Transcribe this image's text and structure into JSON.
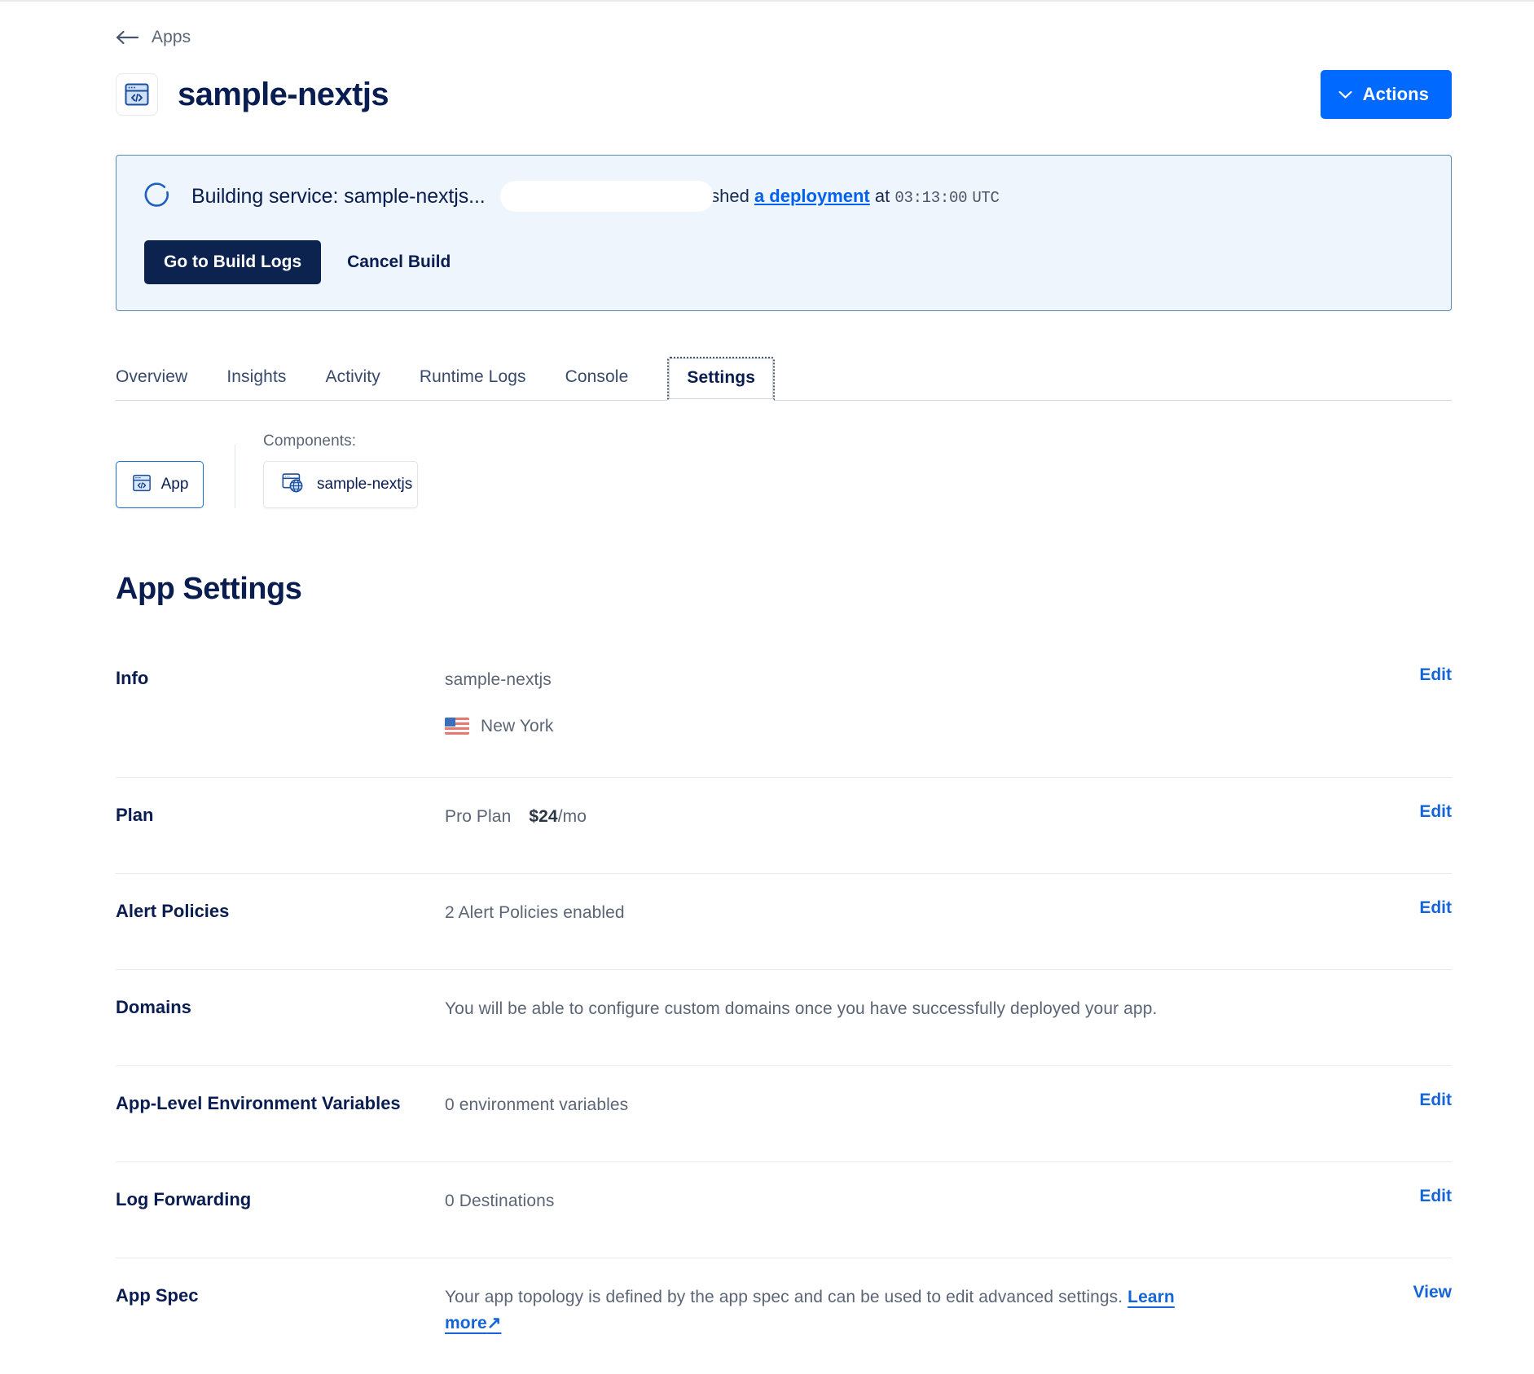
{
  "breadcrumb": {
    "label": "Apps",
    "icon": "arrow-left-icon"
  },
  "header": {
    "app_name": "sample-nextjs",
    "app_icon": "code-window-icon",
    "actions_button": "Actions",
    "actions_chevron": "chevron-down-icon",
    "accent_color": "#0069ff"
  },
  "build_banner": {
    "spinner_icon": "loading-spinner-icon",
    "status_text": "Building service: sample-nextjs...",
    "redacted_user": "",
    "pushed_text": "pushed",
    "deployment_link": "a deployment",
    "at_text": "at",
    "timestamp": "03:13:00",
    "timezone": "UTC",
    "primary_button": "Go to Build Logs",
    "secondary_button": "Cancel Build",
    "background_color": "#eef5fd",
    "border_color": "#5b8cb0",
    "primary_button_color": "#0c2350"
  },
  "tabs": [
    {
      "label": "Overview",
      "active": false
    },
    {
      "label": "Insights",
      "active": false
    },
    {
      "label": "Activity",
      "active": false
    },
    {
      "label": "Runtime Logs",
      "active": false
    },
    {
      "label": "Console",
      "active": false
    },
    {
      "label": "Settings",
      "active": true
    }
  ],
  "component_selector": {
    "app_chip_label": "App",
    "app_chip_icon": "code-window-icon",
    "components_label": "Components:",
    "component_chip_label": "sample-nextjs",
    "component_chip_icon": "web-service-globe-icon"
  },
  "settings": {
    "title": "App Settings",
    "rows": [
      {
        "label": "Info",
        "value": "sample-nextjs",
        "region_flag": "us-flag-icon",
        "region": "New York",
        "action": "Edit"
      },
      {
        "label": "Plan",
        "plan_name": "Pro Plan",
        "price": "$24",
        "price_suffix": "/mo",
        "action": "Edit"
      },
      {
        "label": "Alert Policies",
        "value": "2 Alert Policies enabled",
        "action": "Edit"
      },
      {
        "label": "Domains",
        "value": "You will be able to configure custom domains once you have successfully deployed your app.",
        "action": ""
      },
      {
        "label": "App-Level Environment Variables",
        "value": "0 environment variables",
        "action": "Edit"
      },
      {
        "label": "Log Forwarding",
        "value": "0 Destinations",
        "action": "Edit"
      },
      {
        "label": "App Spec",
        "value": "Your app topology is defined by the app spec and can be used to edit advanced settings.",
        "link": "Learn more",
        "link_icon": "external-link-arrow-icon",
        "action": "View"
      }
    ]
  }
}
